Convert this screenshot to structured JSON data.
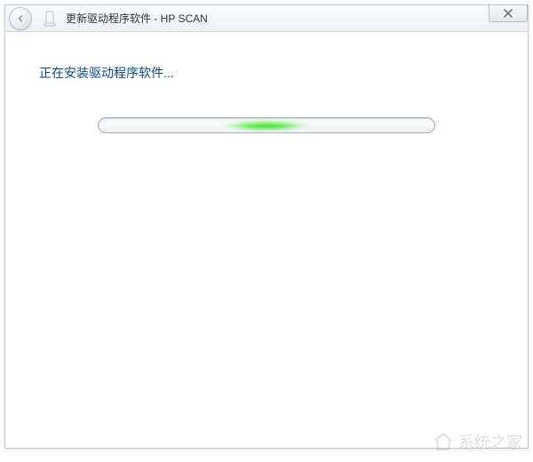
{
  "window": {
    "title": "更新驱动程序软件 - HP SCAN"
  },
  "content": {
    "status_text": "正在安装驱动程序软件..."
  },
  "watermark": {
    "text": "系统之家"
  }
}
